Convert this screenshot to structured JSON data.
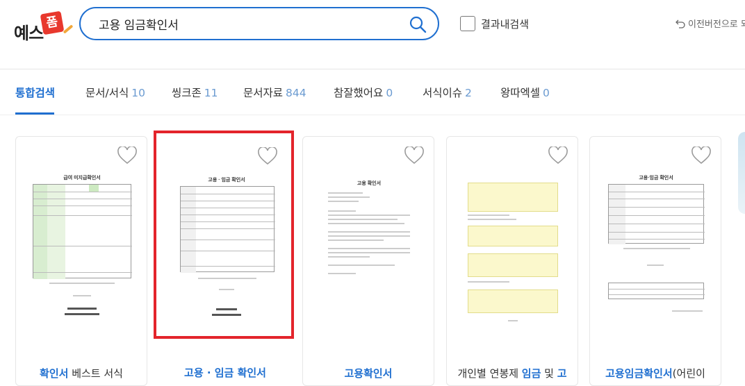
{
  "logo": {
    "text": "예스",
    "badge": "폼"
  },
  "search": {
    "value": "고용 임금확인서",
    "placeholder": ""
  },
  "in_result": {
    "label": "결과내검색"
  },
  "prev_version": {
    "label": "이전버전으로 되"
  },
  "tabs": [
    {
      "label": "통합검색",
      "count": ""
    },
    {
      "label": "문서/서식",
      "count": "10"
    },
    {
      "label": "씽크존",
      "count": "11"
    },
    {
      "label": "문서자료",
      "count": "844"
    },
    {
      "label": "참잘했어요",
      "count": "0"
    },
    {
      "label": "서식이슈",
      "count": "2"
    },
    {
      "label": "왕따엑셀",
      "count": "0"
    }
  ],
  "cards": [
    {
      "thumb_title": "급여 미지급확인서",
      "title_hl": "확인서",
      "title_rest": " 베스트 서식"
    },
    {
      "thumb_title": "고용 · 임금 확인서",
      "title_hl": "고용 · 임금 확인서",
      "title_rest": ""
    },
    {
      "thumb_title": "고용 확인서",
      "title_hl": "고용확인서",
      "title_rest": ""
    },
    {
      "thumb_title": "",
      "title_pre": "개인별 연봉제 ",
      "title_hl": "임금",
      "title_mid": " 및 ",
      "title_hl2": "고"
    },
    {
      "thumb_title": "고용·임금 확인서",
      "title_hl": "고용임금확인서",
      "title_rest": "(어린이"
    }
  ],
  "colors": {
    "accent": "#1f6fd0",
    "selected_border": "#e3242b",
    "logo_badge": "#e8382d"
  },
  "icons": {
    "search": "search-icon",
    "heart": "heart-icon",
    "undo": "undo-icon"
  }
}
